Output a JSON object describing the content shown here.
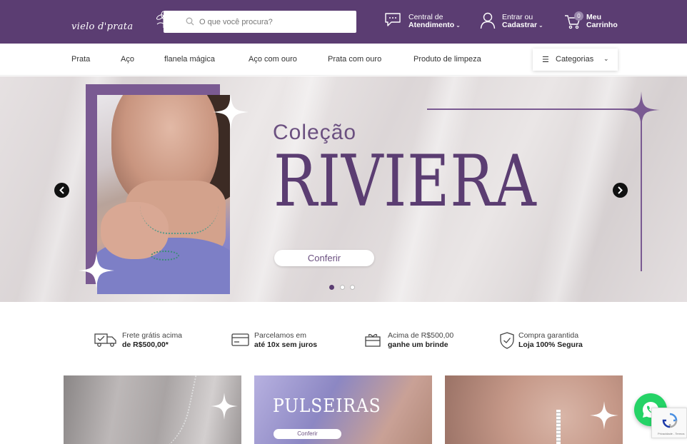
{
  "brand": {
    "logo_text": "vielo d'prata"
  },
  "header": {
    "search_placeholder": "O que você procura?",
    "support": {
      "line1": "Central de",
      "line2": "Atendimento"
    },
    "account": {
      "line1": "Entrar ou",
      "line2": "Cadastrar"
    },
    "cart": {
      "line1": "Meu",
      "line2": "Carrinho",
      "count": "0"
    }
  },
  "nav": {
    "links": [
      "Prata",
      "Aço",
      "flanela mágica",
      "Aço com ouro",
      "Prata com ouro",
      "Produto de limpeza"
    ],
    "categories_label": "Categorias"
  },
  "hero": {
    "kicker": "Coleção",
    "title": "RIVIERA",
    "cta": "Conferir",
    "slides": 3,
    "active_slide": 1
  },
  "benefits": [
    {
      "icon": "truck-icon",
      "line1": "Frete grátis acima",
      "line2": "de R$500,00*"
    },
    {
      "icon": "credit-card-icon",
      "line1": "Parcelamos em",
      "line2": "até 10x sem juros"
    },
    {
      "icon": "gift-icon",
      "line1": "Acima de R$500,00",
      "line2": "ganhe um brinde"
    },
    {
      "icon": "shield-check-icon",
      "line1": "Compra garantida",
      "line2": "Loja 100% Segura"
    }
  ],
  "cards": [
    {
      "label": "",
      "cta": ""
    },
    {
      "label": "PULSEIRAS",
      "cta": "Conferir"
    },
    {
      "label": "",
      "cta": ""
    }
  ],
  "recaptcha": {
    "text": "Privacidade - Termos"
  },
  "colors": {
    "brand_purple": "#5b3d72",
    "accent_purple": "#7a5a92",
    "whatsapp_green": "#25d366"
  }
}
